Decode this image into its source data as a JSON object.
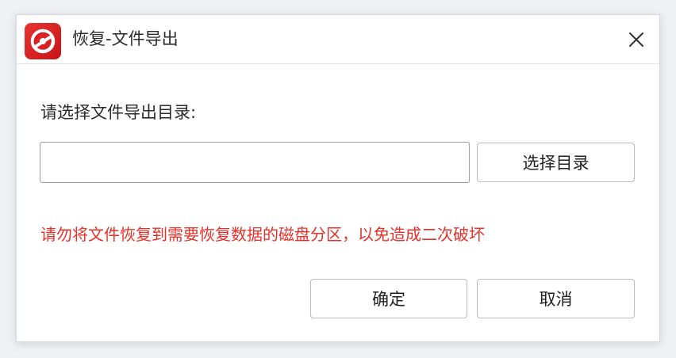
{
  "window": {
    "title": "恢复-文件导出"
  },
  "icons": {
    "app": "app-logo-icon",
    "close": "close-icon"
  },
  "colors": {
    "brand": "#d81e24",
    "warning_text": "#e8302a"
  },
  "form": {
    "prompt_label": "请选择文件导出目录:",
    "directory_value": "",
    "browse_label": "选择目录"
  },
  "warning": {
    "text": "请勿将文件恢复到需要恢复数据的磁盘分区，以免造成二次破坏"
  },
  "footer": {
    "ok_label": "确定",
    "cancel_label": "取消"
  }
}
